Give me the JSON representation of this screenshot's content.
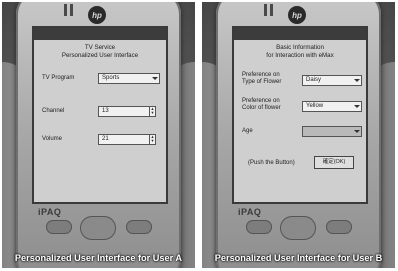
{
  "panel_a": {
    "window_title": [
      "TV Service",
      "Personalized User Interface"
    ],
    "fields": [
      {
        "label": "TV Program",
        "value": "Sports",
        "kind": "dropdown"
      },
      {
        "label": "Channel",
        "value": "13",
        "kind": "stepper"
      },
      {
        "label": "Volume",
        "value": "21",
        "kind": "stepper"
      }
    ],
    "caption": "Personalized User Interface for User A"
  },
  "panel_b": {
    "window_title": [
      "Basic Information",
      "for Interaction with eMax"
    ],
    "fields": [
      {
        "label": "Preference on Type of Flower",
        "value": "Daisy",
        "kind": "dropdown"
      },
      {
        "label": "Preference on Color of flower",
        "value": "Yellow",
        "kind": "dropdown"
      },
      {
        "label": "Age",
        "value": "",
        "kind": "dropdown-disabled"
      }
    ],
    "push_text": "(Push the Button)",
    "button_label": "確定(OK)",
    "caption": "Personalized User Interface for User B"
  },
  "device": {
    "brand_logo": "hp",
    "model": "iPAQ"
  }
}
